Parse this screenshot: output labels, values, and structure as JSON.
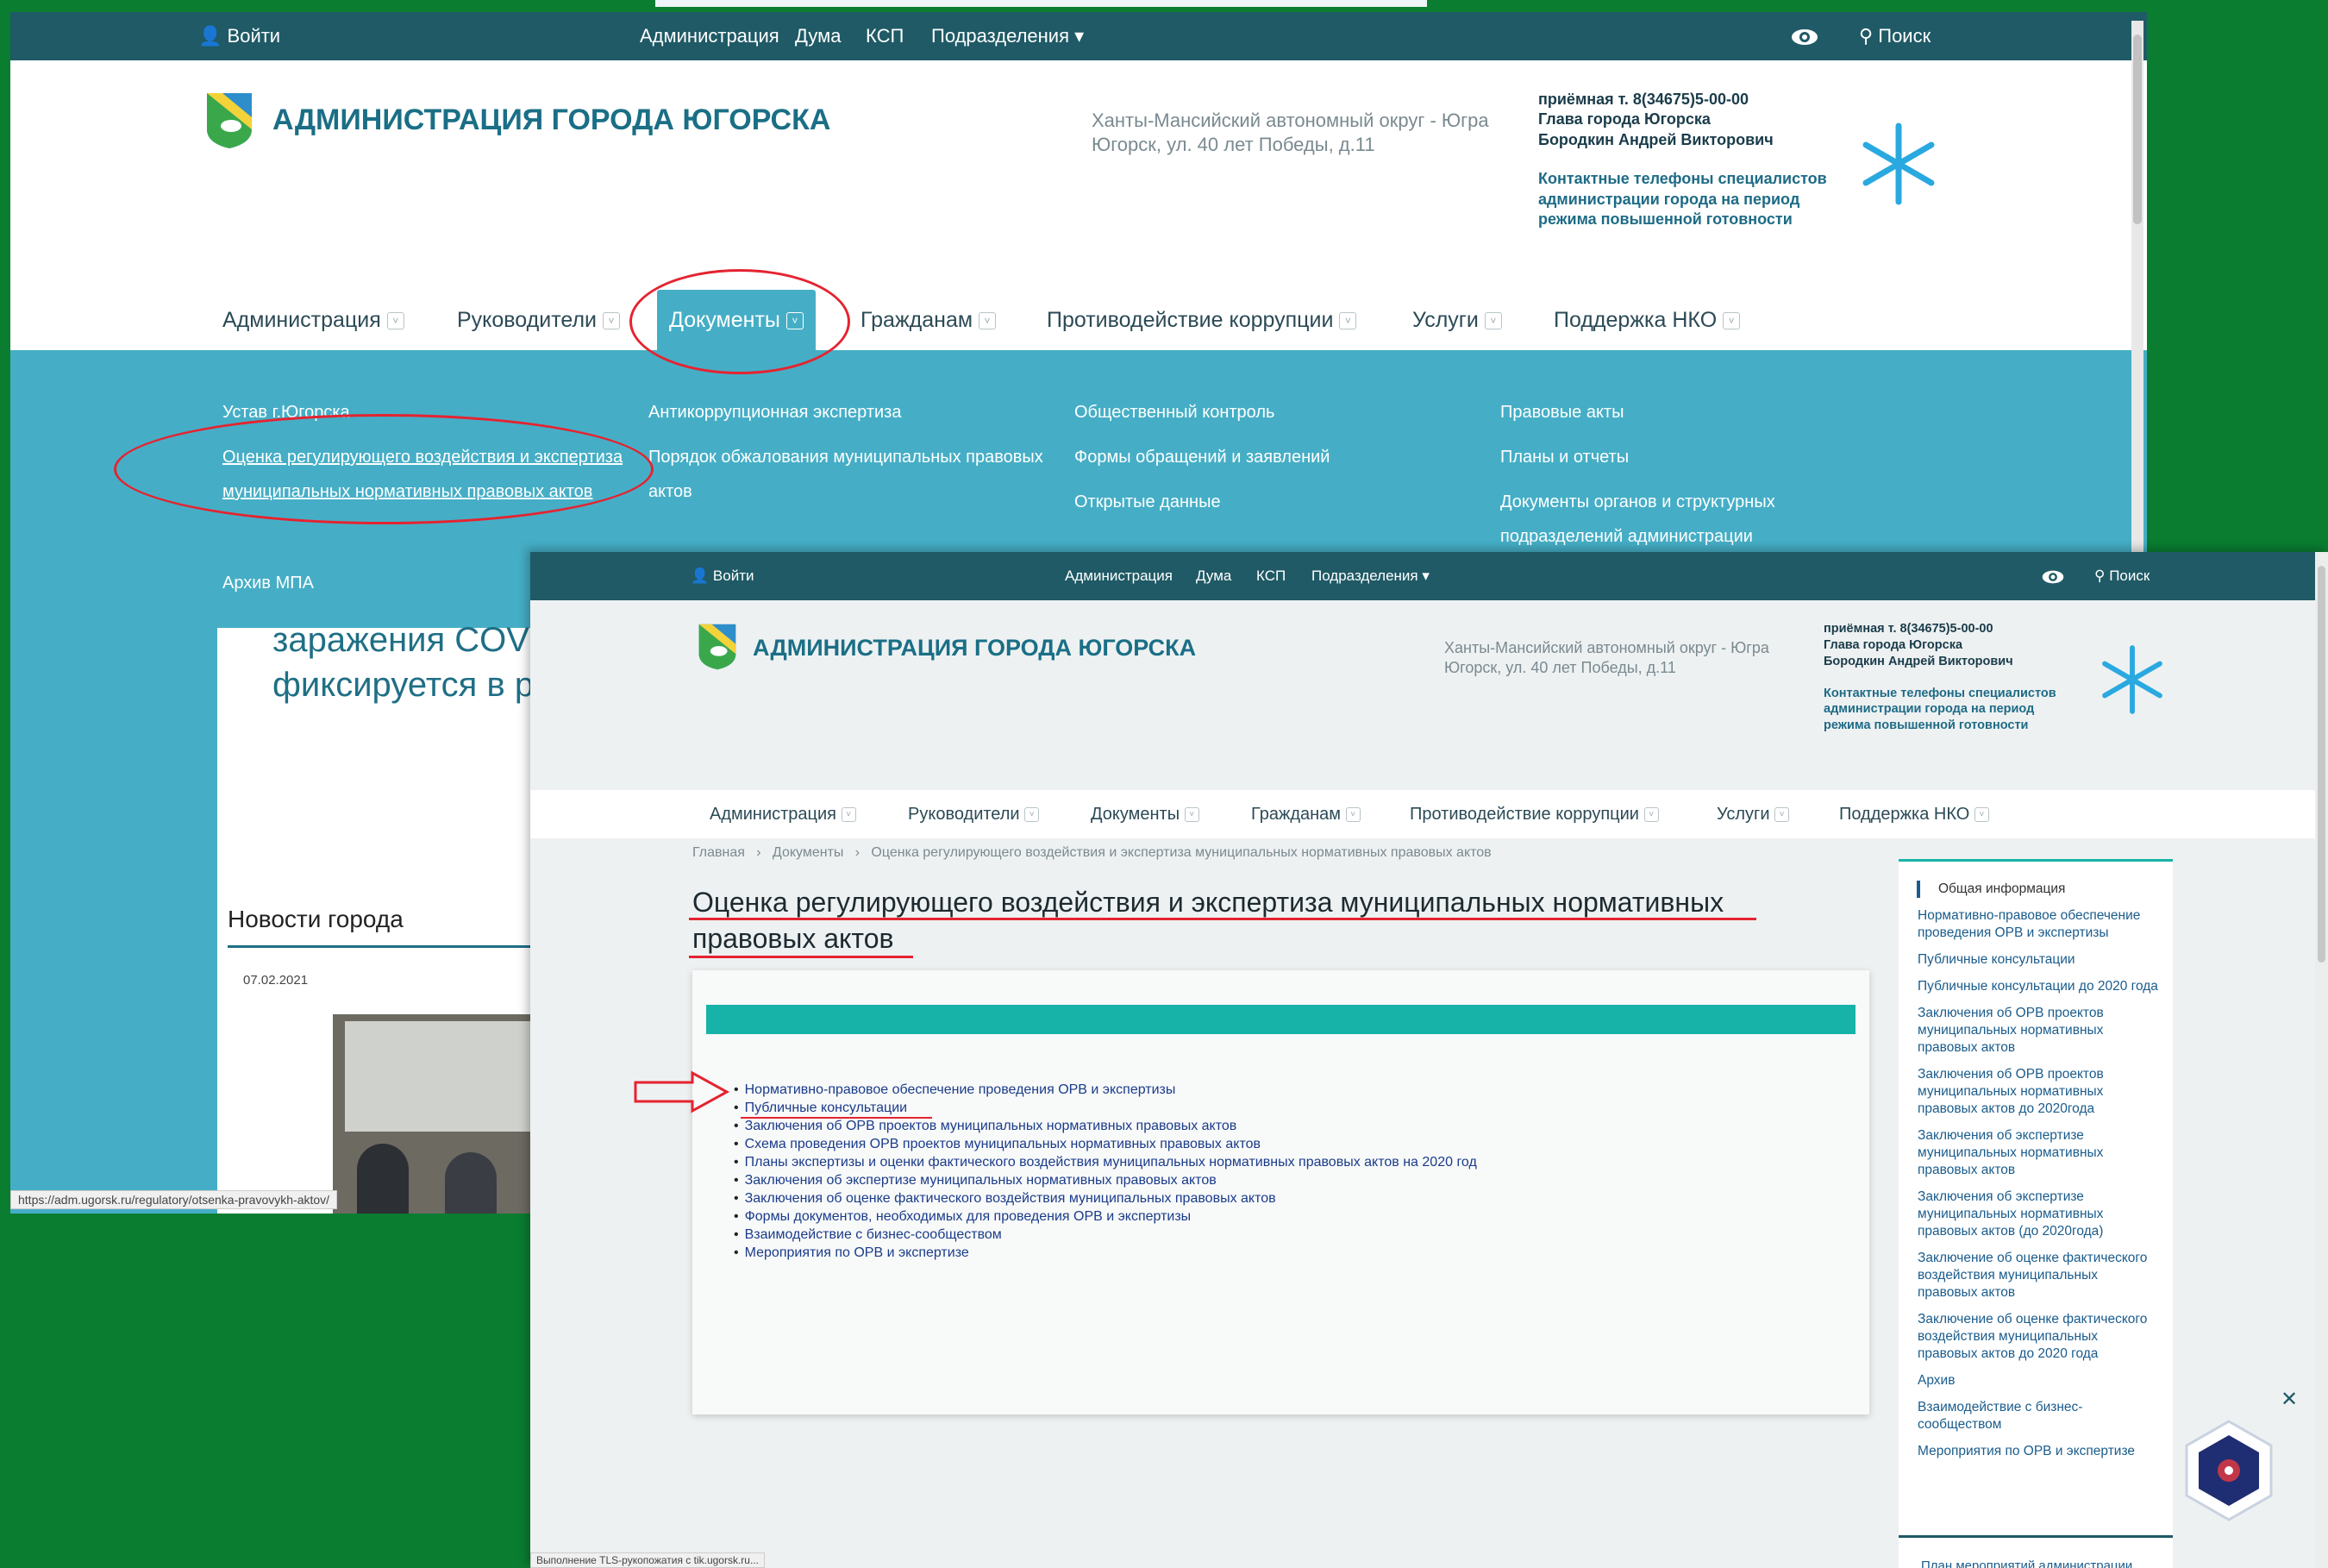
{
  "screen1": {
    "topbar": {
      "login": "Войти",
      "links": [
        "Администрация",
        "Дума",
        "КСП",
        "Подразделения"
      ],
      "search": "Поиск"
    },
    "site_title": "АДМИНИСТРАЦИЯ ГОРОДА ЮГОРСКА",
    "address": [
      "Ханты-Мансийский автономный округ - Югра",
      "Югорск, ул. 40 лет Победы, д.11"
    ],
    "contact": [
      "приёмная т. 8(34675)5-00-00",
      "Глава города Югорска",
      "Бородкин Андрей Викторович"
    ],
    "contact2": [
      "Контактные телефоны специалистов",
      "администрации города на период",
      "режима повышенной готовности"
    ],
    "nav": [
      "Администрация",
      "Руководители",
      "Документы",
      "Гражданам",
      "Противодействие коррупции",
      "Услуги",
      "Поддержка НКО"
    ],
    "dropdown": {
      "col1": [
        "Устав г.Югорска",
        "Оценка регулирующего воздействия и экспертиза",
        "муниципальных нормативных правовых актов",
        "Архив МПА"
      ],
      "col2": [
        "Антикоррупционная экспертиза",
        "Порядок обжалования муниципальных правовых",
        "актов"
      ],
      "col3": [
        "Общественный контроль",
        "Формы обращений и заявлений",
        "Открытые данные"
      ],
      "col4": [
        "Правовые акты",
        "Планы и отчеты",
        "Документы органов и структурных",
        "подразделений администрации"
      ]
    },
    "news_text": [
      "заражения COVID",
      "фиксируется в ре"
    ],
    "news_heading": "Новости города",
    "news_date": "07.02.2021",
    "status_url": "https://adm.ugorsk.ru/regulatory/otsenka-pravovykh-aktov/"
  },
  "screen2": {
    "topbar": {
      "login": "Войти",
      "links": [
        "Администрация",
        "Дума",
        "КСП",
        "Подразделения"
      ],
      "search": "Поиск"
    },
    "site_title": "АДМИНИСТРАЦИЯ ГОРОДА ЮГОРСКА",
    "address": [
      "Ханты-Мансийский автономный округ - Югра",
      "Югорск, ул. 40 лет Победы, д.11"
    ],
    "contact": [
      "приёмная т. 8(34675)5-00-00",
      "Глава города Югорска",
      "Бородкин Андрей Викторович"
    ],
    "contact2": [
      "Контактные телефоны специалистов",
      "администрации города на период",
      "режима повышенной готовности"
    ],
    "nav": [
      "Администрация",
      "Руководители",
      "Документы",
      "Гражданам",
      "Противодействие коррупции",
      "Услуги",
      "Поддержка НКО"
    ],
    "breadcrumb": [
      "Главная",
      "Документы",
      "Оценка регулирующего воздействия и экспертиза муниципальных нормативных правовых актов"
    ],
    "heading": [
      "Оценка регулирующего воздействия и экспертиза муниципальных нормативных",
      "правовых актов"
    ],
    "list": [
      "Нормативно-правовое обеспечение проведения ОРВ и экспертизы",
      "Публичные консультации",
      "Заключения об ОРВ проектов муниципальных нормативных правовых актов",
      "Схема проведения ОРВ проектов муниципальных нормативных правовых актов",
      "Планы экспертизы и оценки фактического воздействия муниципальных нормативных правовых актов на 2020 год",
      "Заключения об экспертизе муниципальных нормативных правовых актов",
      "Заключения об оценке фактического воздействия муниципальных правовых актов",
      "Формы документов, необходимых для проведения ОРВ и экспертизы",
      "Взаимодействие с бизнес-сообществом",
      "Мероприятия по ОРВ и экспертизе"
    ],
    "sidebar": [
      "Общая информация",
      "Нормативно-правовое обеспечение проведения ОРВ и экспертизы",
      "Публичные консультации",
      "Публичные консультации до 2020 года",
      "Заключения об ОРВ проектов муниципальных нормативных правовых актов",
      "Заключения об ОРВ проектов муниципальных нормативных правовых актов до 2020года",
      "Заключения об экспертизе муниципальных нормативных правовых актов",
      "Заключения об экспертизе муниципальных нормативных правовых актов (до 2020года)",
      "Заключение об оценке фактического воздействия муниципальных правовых актов",
      "Заключение об оценке фактического воздействия муниципальных правовых актов до 2020 года",
      "Архив",
      "Взаимодействие с бизнес-сообществом",
      "Мероприятия по ОРВ и экспертизе"
    ],
    "sidebar_next": "План мероприятий администрации",
    "status_text": "Выполнение TLS-рукопожатия с tik.ugorsk.ru..."
  },
  "colors": {
    "background": "#0a7d31",
    "topbar": "#1f5a66",
    "dropdown": "#45aec6",
    "accent_teal": "#17b3a8",
    "annotation_red": "#e52330",
    "title_blue": "#1a6f86"
  }
}
